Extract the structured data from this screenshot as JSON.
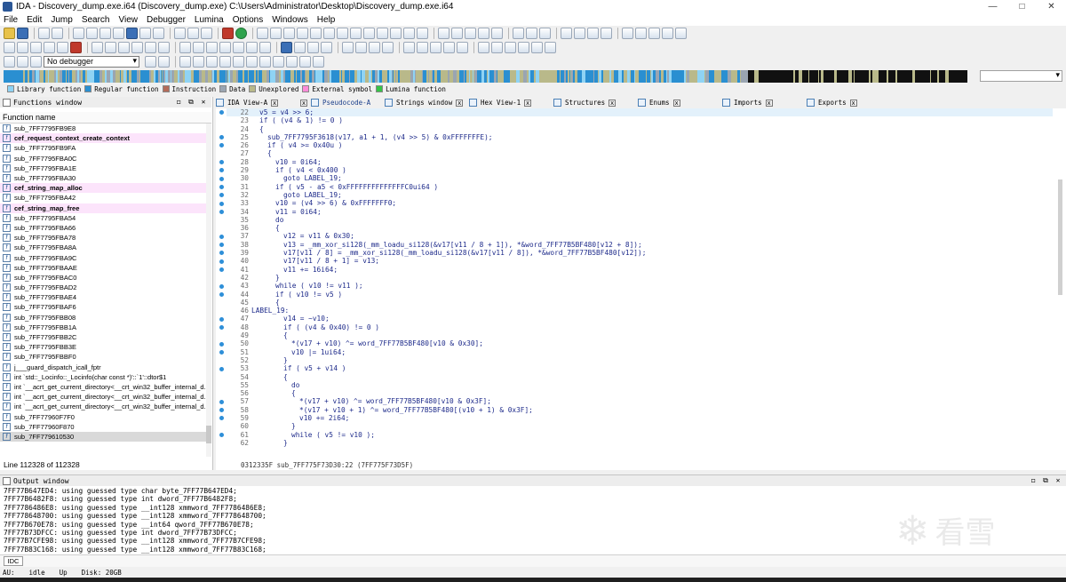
{
  "window": {
    "title": "IDA - Discovery_dump.exe.i64 (Discovery_dump.exe) C:\\Users\\Administrator\\Desktop\\Discovery_dump.exe.i64",
    "minimize": "—",
    "maximize": "□",
    "close": "✕"
  },
  "menu": [
    "File",
    "Edit",
    "Jump",
    "Search",
    "View",
    "Debugger",
    "Lumina",
    "Options",
    "Windows",
    "Help"
  ],
  "toolbar": {
    "debugger_select": "No debugger"
  },
  "legend": [
    {
      "label": "Library function",
      "color": "#8fd3f4"
    },
    {
      "label": "Regular function",
      "color": "#2a8fd1"
    },
    {
      "label": "Instruction",
      "color": "#b36b59"
    },
    {
      "label": "Data",
      "color": "#9aa5b2"
    },
    {
      "label": "Unexplored",
      "color": "#b9b98a"
    },
    {
      "label": "External symbol",
      "color": "#ff8bd8"
    },
    {
      "label": "Lumina function",
      "color": "#35c447"
    }
  ],
  "functions_window": {
    "title": "Functions window",
    "column_header": "Function name",
    "status": "Line 112328 of 112328",
    "rows": [
      {
        "name": "sub_7FF7795FB9E8",
        "type": "reg"
      },
      {
        "name": "cef_request_context_create_context",
        "type": "lib"
      },
      {
        "name": "sub_7FF7795FB9FA",
        "type": "reg"
      },
      {
        "name": "sub_7FF7795FBA0C",
        "type": "reg"
      },
      {
        "name": "sub_7FF7795FBA1E",
        "type": "reg"
      },
      {
        "name": "sub_7FF7795FBA30",
        "type": "reg"
      },
      {
        "name": "cef_string_map_alloc",
        "type": "lib"
      },
      {
        "name": "sub_7FF7795FBA42",
        "type": "reg"
      },
      {
        "name": "cef_string_map_free",
        "type": "lib"
      },
      {
        "name": "sub_7FF7795FBA54",
        "type": "reg"
      },
      {
        "name": "sub_7FF7795FBA66",
        "type": "reg"
      },
      {
        "name": "sub_7FF7795FBA78",
        "type": "reg"
      },
      {
        "name": "sub_7FF7795FBA8A",
        "type": "reg"
      },
      {
        "name": "sub_7FF7795FBA9C",
        "type": "reg"
      },
      {
        "name": "sub_7FF7795FBAAE",
        "type": "reg"
      },
      {
        "name": "sub_7FF7795FBAC0",
        "type": "reg"
      },
      {
        "name": "sub_7FF7795FBAD2",
        "type": "reg"
      },
      {
        "name": "sub_7FF7795FBAE4",
        "type": "reg"
      },
      {
        "name": "sub_7FF7795FBAF6",
        "type": "reg"
      },
      {
        "name": "sub_7FF7795FBB08",
        "type": "reg"
      },
      {
        "name": "sub_7FF7795FBB1A",
        "type": "reg"
      },
      {
        "name": "sub_7FF7795FBB2C",
        "type": "reg"
      },
      {
        "name": "sub_7FF7795FBB3E",
        "type": "reg"
      },
      {
        "name": "sub_7FF7795FBBF0",
        "type": "reg"
      },
      {
        "name": "j___guard_dispatch_icall_fptr",
        "type": "reg"
      },
      {
        "name": "int `std::_Locinfo::_Locinfo(char const *)'::`1'::dtor$1",
        "type": "reg"
      },
      {
        "name": "int `__acrt_get_current_directory<__crt_win32_buffer_internal_d...",
        "type": "reg"
      },
      {
        "name": "int `__acrt_get_current_directory<__crt_win32_buffer_internal_d...",
        "type": "reg"
      },
      {
        "name": "int `__acrt_get_current_directory<__crt_win32_buffer_internal_d...",
        "type": "reg"
      },
      {
        "name": "sub_7FF77960F7F0",
        "type": "reg"
      },
      {
        "name": "sub_7FF77960F870",
        "type": "reg"
      },
      {
        "name": "sub_7FF779610530",
        "type": "sel"
      }
    ]
  },
  "tabs": [
    {
      "label": "IDA View-A",
      "close": "x"
    },
    {
      "label": "Pseudocode-A",
      "close": "x"
    },
    {
      "label": "Strings window",
      "close": "x"
    },
    {
      "label": "Hex View-1",
      "close": "x"
    },
    {
      "label": "Structures",
      "close": "x"
    },
    {
      "label": "Enums",
      "close": "x"
    },
    {
      "label": "Imports",
      "close": "x"
    },
    {
      "label": "Exports",
      "close": "x"
    }
  ],
  "pseudocode": {
    "status": "0312335F sub_7FF775F73D30:22 (7FF775F73D5F)",
    "lines": [
      {
        "n": "22",
        "code": "v5 = v4 >> 6;",
        "bp": true,
        "ind": 1
      },
      {
        "n": "23",
        "code": "if ( (v4 & 1) != 0 )",
        "bp": false,
        "ind": 1
      },
      {
        "n": "24",
        "code": "{",
        "bp": false,
        "ind": 1
      },
      {
        "n": "25",
        "code": "sub_7FF7795F3618(v17, a1 + 1, (v4 >> 5) & 0xFFFFFFFE);",
        "bp": true,
        "ind": 2
      },
      {
        "n": "26",
        "code": "if ( v4 >= 0x40u )",
        "bp": true,
        "ind": 2
      },
      {
        "n": "27",
        "code": "{",
        "bp": false,
        "ind": 2
      },
      {
        "n": "28",
        "code": "v10 = 0i64;",
        "bp": true,
        "ind": 3
      },
      {
        "n": "29",
        "code": "if ( v4 < 0x400 )",
        "bp": true,
        "ind": 3
      },
      {
        "n": "30",
        "code": "goto LABEL_19;",
        "bp": true,
        "ind": 4
      },
      {
        "n": "31",
        "code": "if ( v5 - a5 < 0xFFFFFFFFFFFFFFC0ui64 )",
        "bp": true,
        "ind": 3
      },
      {
        "n": "32",
        "code": "goto LABEL_19;",
        "bp": true,
        "ind": 4
      },
      {
        "n": "33",
        "code": "v10 = (v4 >> 6) & 0xFFFFFFF0;",
        "bp": true,
        "ind": 3
      },
      {
        "n": "34",
        "code": "v11 = 0i64;",
        "bp": true,
        "ind": 3
      },
      {
        "n": "35",
        "code": "do",
        "bp": false,
        "ind": 3
      },
      {
        "n": "36",
        "code": "{",
        "bp": false,
        "ind": 3
      },
      {
        "n": "37",
        "code": "v12 = v11 & 0x30;",
        "bp": true,
        "ind": 4
      },
      {
        "n": "38",
        "code": "v13 = _mm_xor_si128(_mm_loadu_si128(&v17[v11 / 8 + 1]), *&word_7FF77B5BF480[v12 + 8]);",
        "bp": true,
        "ind": 4
      },
      {
        "n": "39",
        "code": "v17[v11 / 8] = _mm_xor_si128(_mm_loadu_si128(&v17[v11 / 8]), *&word_7FF77B5BF480[v12]);",
        "bp": true,
        "ind": 4
      },
      {
        "n": "40",
        "code": "v17[v11 / 8 + 1] = v13;",
        "bp": true,
        "ind": 4
      },
      {
        "n": "41",
        "code": "v11 += 16i64;",
        "bp": true,
        "ind": 4
      },
      {
        "n": "42",
        "code": "}",
        "bp": false,
        "ind": 3
      },
      {
        "n": "43",
        "code": "while ( v10 != v11 );",
        "bp": true,
        "ind": 3
      },
      {
        "n": "44",
        "code": "if ( v10 != v5 )",
        "bp": true,
        "ind": 3
      },
      {
        "n": "45",
        "code": "{",
        "bp": false,
        "ind": 3
      },
      {
        "n": "46",
        "code": "LABEL_19:",
        "bp": false,
        "ind": 0
      },
      {
        "n": "47",
        "code": "v14 = ~v10;",
        "bp": true,
        "ind": 4
      },
      {
        "n": "48",
        "code": "if ( (v4 & 0x40) != 0 )",
        "bp": true,
        "ind": 4
      },
      {
        "n": "49",
        "code": "{",
        "bp": false,
        "ind": 4
      },
      {
        "n": "50",
        "code": "*(v17 + v10) ^= word_7FF77B5BF480[v10 & 0x30];",
        "bp": true,
        "ind": 5
      },
      {
        "n": "51",
        "code": "v10 |= 1ui64;",
        "bp": true,
        "ind": 5
      },
      {
        "n": "52",
        "code": "}",
        "bp": false,
        "ind": 4
      },
      {
        "n": "53",
        "code": "if ( v5 + v14 )",
        "bp": true,
        "ind": 4
      },
      {
        "n": "54",
        "code": "{",
        "bp": false,
        "ind": 4
      },
      {
        "n": "55",
        "code": "do",
        "bp": false,
        "ind": 5
      },
      {
        "n": "56",
        "code": "{",
        "bp": false,
        "ind": 5
      },
      {
        "n": "57",
        "code": "*(v17 + v10) ^= word_7FF77B5BF480[v10 & 0x3F];",
        "bp": true,
        "ind": 6
      },
      {
        "n": "58",
        "code": "*(v17 + v10 + 1) ^= word_7FF77B5BF480[(v10 + 1) & 0x3F];",
        "bp": true,
        "ind": 6
      },
      {
        "n": "59",
        "code": "v10 += 2i64;",
        "bp": true,
        "ind": 6
      },
      {
        "n": "60",
        "code": "}",
        "bp": false,
        "ind": 5
      },
      {
        "n": "61",
        "code": "while ( v5 != v10 );",
        "bp": true,
        "ind": 5
      },
      {
        "n": "62",
        "code": "}",
        "bp": false,
        "ind": 4
      }
    ]
  },
  "output_window": {
    "title": "Output window",
    "lines": [
      "7FF77B647ED4: using guessed type char byte_7FF77B647ED4;",
      "7FF77B6482F8: using guessed type int dword_7FF77B6482F8;",
      "7FF7786486E8: using guessed type __int128 xmmword_7FF7786486E8;",
      "7FF778648700: using guessed type __int128 xmmword_7FF778648700;",
      "7FF77B670E78: using guessed type __int64 qword_7FF77B670E78;",
      "7FF77B73DFCC: using guessed type int dword_7FF77B73DFCC;",
      "7FF77B7CFE98: using guessed type __int128 xmmword_7FF77B7CFE98;",
      "7FF77B83C168: using guessed type __int128 xmmword_7FF77B83C168;"
    ],
    "idc_button": "IDC"
  },
  "statusbar": {
    "au": "AU:",
    "state": "idle",
    "direction": "Up",
    "disk": "Disk: 20GB"
  },
  "watermark": {
    "text": "看雪"
  }
}
